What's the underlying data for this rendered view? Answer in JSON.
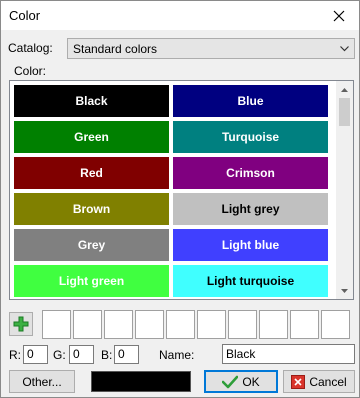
{
  "window": {
    "title": "Color"
  },
  "catalog": {
    "label": "Catalog:",
    "value": "Standard colors"
  },
  "color_label": "Color:",
  "swatches": [
    {
      "label": "Black",
      "bg": "#000000",
      "fg": "#ffffff"
    },
    {
      "label": "Blue",
      "bg": "#000080",
      "fg": "#ffffff"
    },
    {
      "label": "Green",
      "bg": "#008000",
      "fg": "#ffffff"
    },
    {
      "label": "Turquoise",
      "bg": "#008080",
      "fg": "#ffffff"
    },
    {
      "label": "Red",
      "bg": "#800000",
      "fg": "#ffffff"
    },
    {
      "label": "Crimson",
      "bg": "#800080",
      "fg": "#ffffff"
    },
    {
      "label": "Brown",
      "bg": "#808000",
      "fg": "#ffffff"
    },
    {
      "label": "Light grey",
      "bg": "#c0c0c0",
      "fg": "#000000"
    },
    {
      "label": "Grey",
      "bg": "#808080",
      "fg": "#ffffff"
    },
    {
      "label": "Light blue",
      "bg": "#4040ff",
      "fg": "#ffffff"
    },
    {
      "label": "Light green",
      "bg": "#40ff40",
      "fg": "#ffffff"
    },
    {
      "label": "Light turquoise",
      "bg": "#40ffff",
      "fg": "#000000"
    }
  ],
  "rgb": {
    "r_label": "R:",
    "r": "0",
    "g_label": "G:",
    "g": "0",
    "b_label": "B:",
    "b": "0"
  },
  "name": {
    "label": "Name:",
    "value": "Black"
  },
  "buttons": {
    "other": "Other...",
    "ok": "OK",
    "cancel": "Cancel"
  },
  "preview_color": "#000000"
}
